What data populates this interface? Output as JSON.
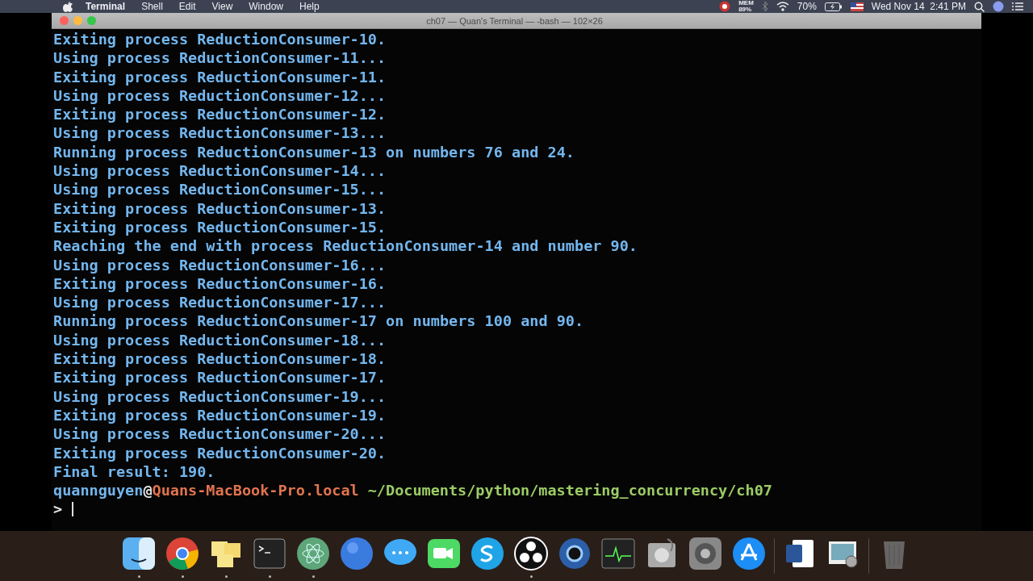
{
  "menu_bar": {
    "app_name": "Terminal",
    "menus": [
      "Shell",
      "Edit",
      "View",
      "Window",
      "Help"
    ],
    "mem_label": "MEM",
    "mem_value": "89%",
    "battery": "70%",
    "clock": "Wed Nov 14  2:41 PM"
  },
  "window": {
    "title": "ch07 — Quan's Terminal — -bash — 102×26"
  },
  "terminal": {
    "lines": [
      "Exiting process ReductionConsumer-10.",
      "Using process ReductionConsumer-11...",
      "Exiting process ReductionConsumer-11.",
      "Using process ReductionConsumer-12...",
      "Exiting process ReductionConsumer-12.",
      "Using process ReductionConsumer-13...",
      "Running process ReductionConsumer-13 on numbers 76 and 24.",
      "Using process ReductionConsumer-14...",
      "Using process ReductionConsumer-15...",
      "Exiting process ReductionConsumer-13.",
      "Exiting process ReductionConsumer-15.",
      "Reaching the end with process ReductionConsumer-14 and number 90.",
      "Using process ReductionConsumer-16...",
      "Exiting process ReductionConsumer-16.",
      "Using process ReductionConsumer-17...",
      "Running process ReductionConsumer-17 on numbers 100 and 90.",
      "Using process ReductionConsumer-18...",
      "Exiting process ReductionConsumer-18.",
      "Exiting process ReductionConsumer-17.",
      "Using process ReductionConsumer-19...",
      "Exiting process ReductionConsumer-19.",
      "Using process ReductionConsumer-20...",
      "Exiting process ReductionConsumer-20.",
      "Final result: 190."
    ],
    "prompt": {
      "user": "quannguyen",
      "at": "@",
      "host": "Quans-MacBook-Pro.local",
      "path": "~/Documents/python/mastering_concurrency/ch07"
    },
    "input_prompt": ">"
  },
  "dock": {
    "groups": [
      [
        {
          "kind": "finder",
          "running": true
        },
        {
          "kind": "chrome",
          "running": true
        },
        {
          "kind": "stickies",
          "running": true
        },
        {
          "kind": "terminal",
          "running": true
        },
        {
          "kind": "atom",
          "running": true
        },
        {
          "kind": "r",
          "running": false
        },
        {
          "kind": "messages",
          "running": false
        },
        {
          "kind": "facetime",
          "running": false
        },
        {
          "kind": "skype",
          "running": false
        },
        {
          "kind": "obs",
          "running": true
        },
        {
          "kind": "quicktime",
          "running": false
        },
        {
          "kind": "activity",
          "running": false
        },
        {
          "kind": "disk",
          "running": false
        },
        {
          "kind": "settings",
          "running": false
        },
        {
          "kind": "appstore",
          "running": false
        }
      ],
      [
        {
          "kind": "word",
          "running": false
        },
        {
          "kind": "preview",
          "running": false
        }
      ],
      [
        {
          "kind": "trash",
          "running": false
        }
      ]
    ]
  }
}
